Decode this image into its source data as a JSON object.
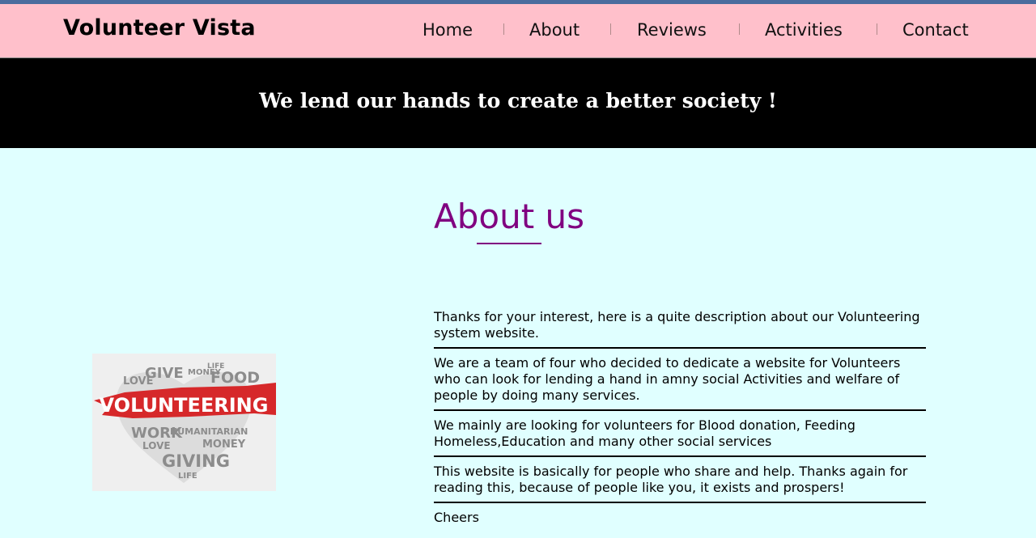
{
  "brand": {
    "name": "Volunteer Vista"
  },
  "nav": {
    "items": [
      {
        "label": "Home"
      },
      {
        "label": "About"
      },
      {
        "label": "Reviews"
      },
      {
        "label": "Activities"
      },
      {
        "label": "Contact"
      }
    ],
    "separator": "|"
  },
  "banner": {
    "tagline": "We lend our hands to create a better society !"
  },
  "about": {
    "title": "About us",
    "paragraphs": [
      "Thanks for your interest, here is a quite description about our Volunteering system website.",
      "We are a team of four who decided to dedicate a website for Volunteers who can look for lending a hand in amny social Activities and welfare of people by doing many services.",
      "We mainly are looking for volunteers for Blood donation, Feeding Homeless,Education and many other social services",
      "This website is basically for people who share and help. Thanks again for reading this, because of people like you, it exists and prospers!",
      "Cheers"
    ]
  },
  "image": {
    "headline": "VOLUNTEERING",
    "words": [
      "GIVE",
      "MONEY",
      "FOOD",
      "LOVE",
      "WORK",
      "HUMANITARIAN",
      "MONEY",
      "LOVE",
      "GIVING",
      "LIFE",
      "LIFE"
    ]
  },
  "colors": {
    "navbar_bg": "#ffc0cb",
    "banner_bg": "#000000",
    "page_bg": "#e0ffff",
    "title_color": "#800080",
    "heart_gray": "#8c8c8c",
    "brush_red": "#d6282a"
  }
}
